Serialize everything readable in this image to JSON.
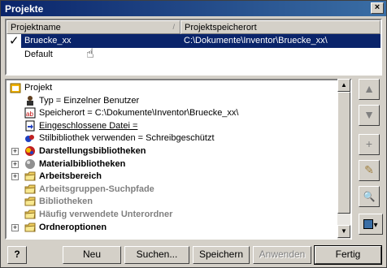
{
  "window": {
    "title": "Projekte",
    "close_glyph": "×"
  },
  "projects": {
    "columns": [
      "Projektname",
      "Projektspeicherort"
    ],
    "rows": [
      {
        "name": "Bruecke_xx",
        "location": "C:\\Dokumente\\Inventor\\Bruecke_xx\\",
        "active": true,
        "selected": true
      },
      {
        "name": "Default",
        "location": "",
        "active": false,
        "selected": false
      }
    ],
    "check_glyph": "✓"
  },
  "tree": {
    "items": [
      {
        "label": "Projekt",
        "level": 0,
        "icon": "project-icon",
        "expander": "",
        "style": "normal"
      },
      {
        "label": "Typ = Einzelner Benutzer",
        "level": 1,
        "icon": "user-icon",
        "expander": "",
        "style": "normal"
      },
      {
        "label": "Speicherort = C:\\Dokumente\\Inventor\\Bruecke_xx\\",
        "level": 1,
        "icon": "ab-icon",
        "expander": "",
        "style": "normal"
      },
      {
        "label": "Eingeschlossene Datei =",
        "level": 1,
        "icon": "include-file-icon",
        "expander": "",
        "style": "underline"
      },
      {
        "label": "Stilbibliothek verwenden = Schreibgeschützt",
        "level": 1,
        "icon": "style-library-icon",
        "expander": "",
        "style": "normal"
      },
      {
        "label": "Darstellungsbibliotheken",
        "level": 1,
        "icon": "appearance-library-icon",
        "expander": "+",
        "style": "bold"
      },
      {
        "label": "Materialbibliotheken",
        "level": 1,
        "icon": "material-library-icon",
        "expander": "+",
        "style": "bold"
      },
      {
        "label": "Arbeitsbereich",
        "level": 1,
        "icon": "folder-icon",
        "expander": "+",
        "style": "bold"
      },
      {
        "label": "Arbeitsgruppen-Suchpfade",
        "level": 1,
        "icon": "folder-icon",
        "expander": "",
        "style": "gray-bold"
      },
      {
        "label": "Bibliotheken",
        "level": 1,
        "icon": "folder-icon",
        "expander": "",
        "style": "gray-bold"
      },
      {
        "label": "Häufig verwendete Unterordner",
        "level": 1,
        "icon": "folder-icon",
        "expander": "",
        "style": "gray-bold"
      },
      {
        "label": "Ordneroptionen",
        "level": 1,
        "icon": "folder-icon",
        "expander": "+",
        "style": "bold"
      }
    ]
  },
  "side_buttons": [
    {
      "name": "move-up-button",
      "glyph": "▲"
    },
    {
      "name": "move-down-button",
      "glyph": "▼"
    },
    {
      "name": "add-button",
      "glyph": "+"
    },
    {
      "name": "edit-button",
      "glyph": "✎"
    },
    {
      "name": "search-button",
      "glyph": "🔍"
    },
    {
      "name": "options-button",
      "glyph": "▾"
    }
  ],
  "footer": {
    "help_label": "?",
    "new_label": "Neu",
    "search_label": "Suchen...",
    "save_label": "Speichern",
    "apply_label": "Anwenden",
    "done_label": "Fertig"
  }
}
